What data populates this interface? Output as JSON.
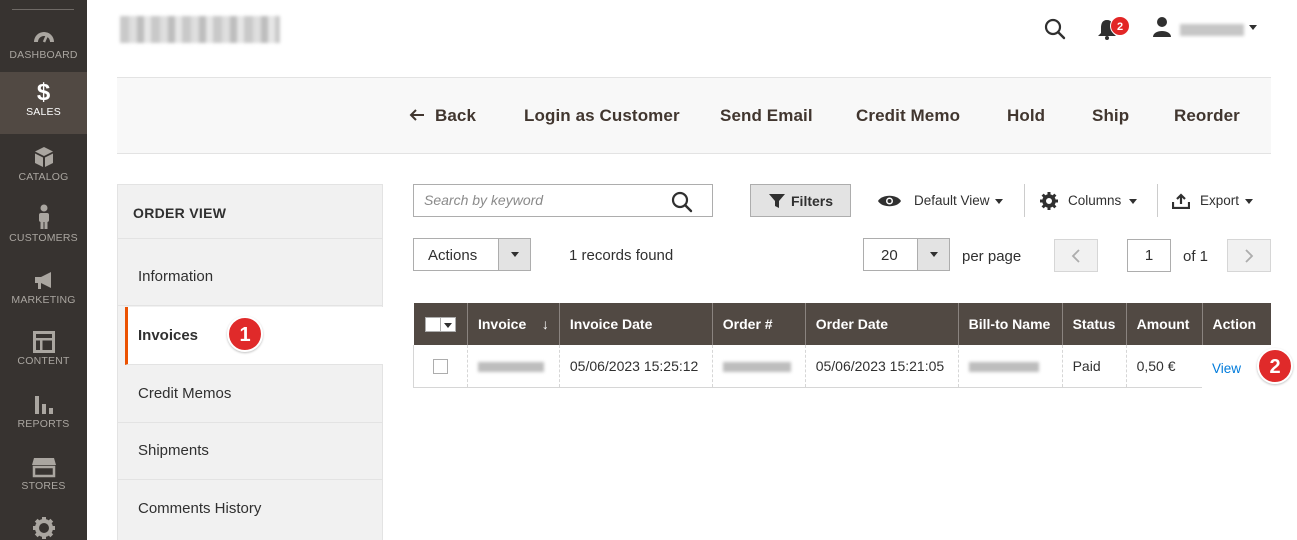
{
  "nav": {
    "items": [
      {
        "id": "dashboard",
        "label": "DASHBOARD",
        "icon": "dashboard-icon",
        "active": false
      },
      {
        "id": "sales",
        "label": "SALES",
        "icon": "dollar-icon",
        "active": true
      },
      {
        "id": "catalog",
        "label": "CATALOG",
        "icon": "cube-icon",
        "active": false
      },
      {
        "id": "customers",
        "label": "CUSTOMERS",
        "icon": "person-icon",
        "active": false
      },
      {
        "id": "marketing",
        "label": "MARKETING",
        "icon": "megaphone-icon",
        "active": false
      },
      {
        "id": "content",
        "label": "CONTENT",
        "icon": "layout-icon",
        "active": false
      },
      {
        "id": "reports",
        "label": "REPORTS",
        "icon": "bar-chart-icon",
        "active": false
      },
      {
        "id": "stores",
        "label": "STORES",
        "icon": "storefront-icon",
        "active": false
      },
      {
        "id": "system",
        "label": "",
        "icon": "gear-icon",
        "active": false
      }
    ]
  },
  "header": {
    "notification_count": "2"
  },
  "actions": {
    "back": "Back",
    "login_as_customer": "Login as Customer",
    "send_email": "Send Email",
    "credit_memo": "Credit Memo",
    "hold": "Hold",
    "ship": "Ship",
    "reorder": "Reorder"
  },
  "tabs": {
    "title": "ORDER VIEW",
    "items": [
      "Information",
      "Invoices",
      "Credit Memos",
      "Shipments",
      "Comments History"
    ],
    "active_index": 1
  },
  "markers": {
    "first": "1",
    "second": "2"
  },
  "toolbar": {
    "search_placeholder": "Search by keyword",
    "filters": "Filters",
    "default_view": "Default View",
    "columns": "Columns",
    "export": "Export",
    "mass_actions": "Actions",
    "records_found": "1 records found",
    "page_size": "20",
    "per_page": "per page",
    "current_page": "1",
    "of_pages": "of 1"
  },
  "grid": {
    "columns": [
      "Invoice",
      "Invoice Date",
      "Order #",
      "Order Date",
      "Bill-to Name",
      "Status",
      "Amount",
      "Action"
    ],
    "sort_indicator": "↓",
    "rows": [
      {
        "invoice_date": "05/06/2023 15:25:12",
        "order_date": "05/06/2023 15:21:05",
        "status": "Paid",
        "amount": "0,50 €",
        "action": "View"
      }
    ]
  },
  "colors": {
    "nav_bg": "#373330",
    "nav_active": "#514943",
    "accent": "#eb5202",
    "grid_header": "#514943",
    "link": "#007bdb",
    "marker": "#e02a2a"
  }
}
